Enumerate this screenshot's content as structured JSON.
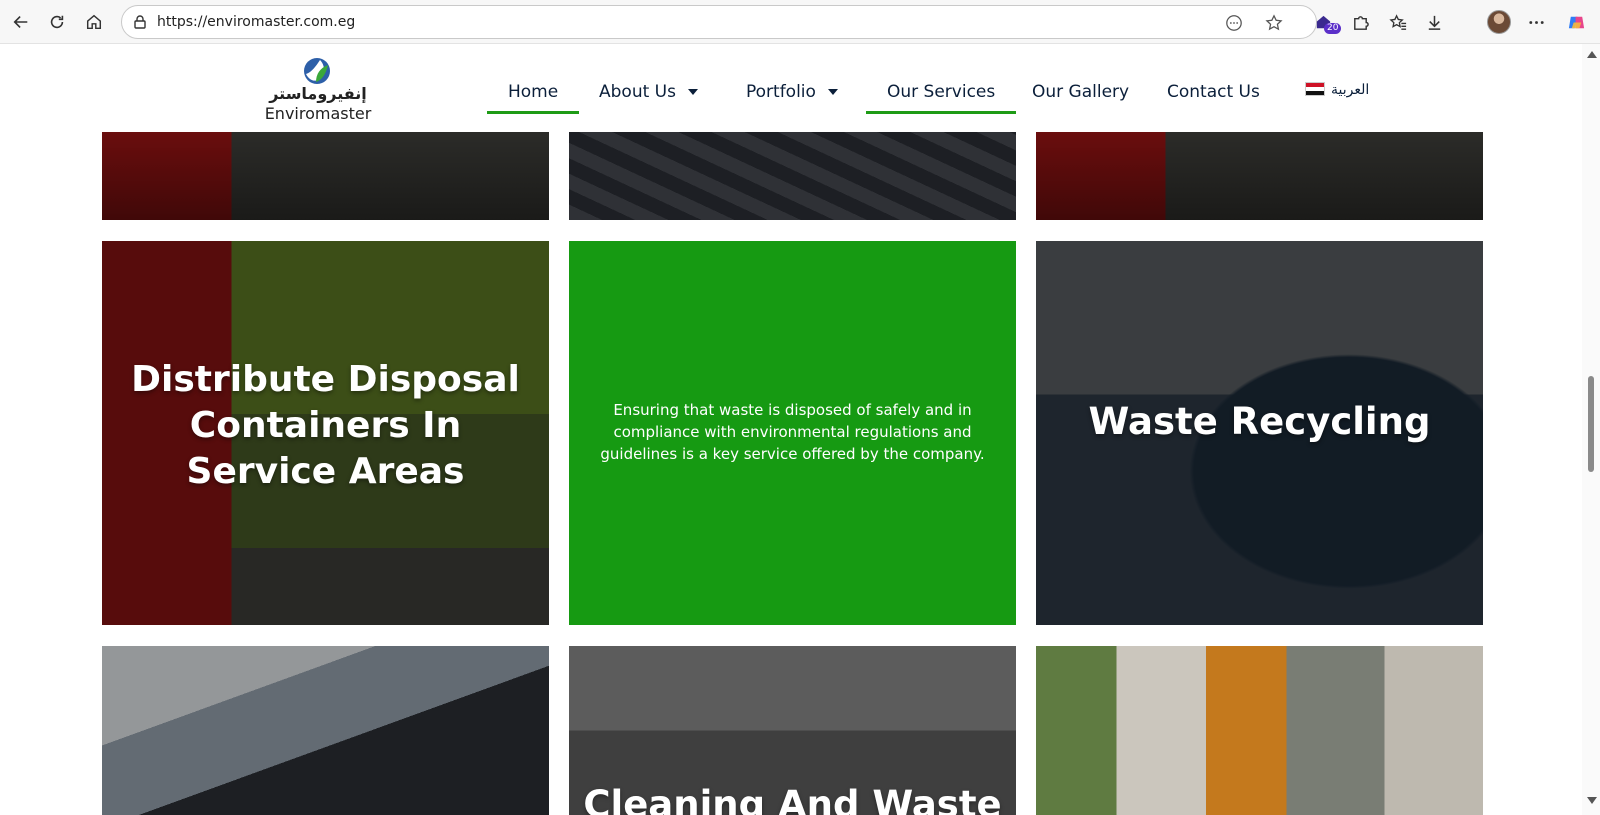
{
  "browser": {
    "url": "https://enviromaster.com.eg",
    "extensions_badge": "20"
  },
  "site": {
    "logo_arabic": "إنفيروماستر",
    "logo_english": "Enviromaster",
    "menu": {
      "home": "Home",
      "about": "About Us",
      "portfolio": "Portfolio",
      "services": "Our Services",
      "gallery": "Our Gallery",
      "contact": "Contact Us",
      "language": "العربية"
    },
    "accent_color": "#1e9b16"
  },
  "services": {
    "card_distribute_title": "Distribute Disposal Containers In Service Areas",
    "card_green_text": "Ensuring that waste is disposed of safely and in compliance with environmental regulations and guidelines is a key service offered by the company.",
    "card_recycling_title": "Waste Recycling",
    "card_cleaning_title": "Cleaning And Waste"
  }
}
